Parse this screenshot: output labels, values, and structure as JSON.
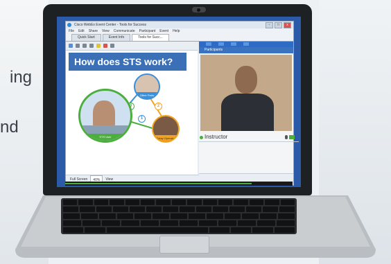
{
  "background": {
    "side_text_line1": "ing",
    "side_text_line2": "nd"
  },
  "window": {
    "title": "Cisco WebEx Event Center - Tools for Success",
    "menu": [
      "File",
      "Edit",
      "Share",
      "View",
      "Communicate",
      "Participant",
      "Event",
      "Help"
    ],
    "tabs": [
      {
        "label": "Quick Start",
        "active": false
      },
      {
        "label": "Event Info",
        "active": false
      },
      {
        "label": "Tools for Succ...",
        "active": true
      }
    ],
    "win_buttons": [
      "-",
      "□",
      "x"
    ]
  },
  "slide": {
    "title": "How does STS work?",
    "people": [
      {
        "label": "Other Party"
      },
      {
        "label": "Relay Operator"
      },
      {
        "label": "STS User"
      }
    ],
    "step_numbers": [
      "1",
      "2",
      "3"
    ],
    "footer": {
      "full_screen": "Full Screen",
      "zoom": "40%",
      "view": "View"
    }
  },
  "participants_panel": {
    "header": "Participants",
    "instructor_label": "Instructor"
  },
  "colors": {
    "screen_bg": "#2a5aa8",
    "slide_title_bg": "#3b6fb6",
    "accent_green": "#4cae3c",
    "accent_orange": "#f2a31f",
    "accent_blue": "#3a8fd9"
  },
  "icons": [
    "webex-logo-icon",
    "camera-icon",
    "participants-icon",
    "mic-icon",
    "video-icon"
  ]
}
